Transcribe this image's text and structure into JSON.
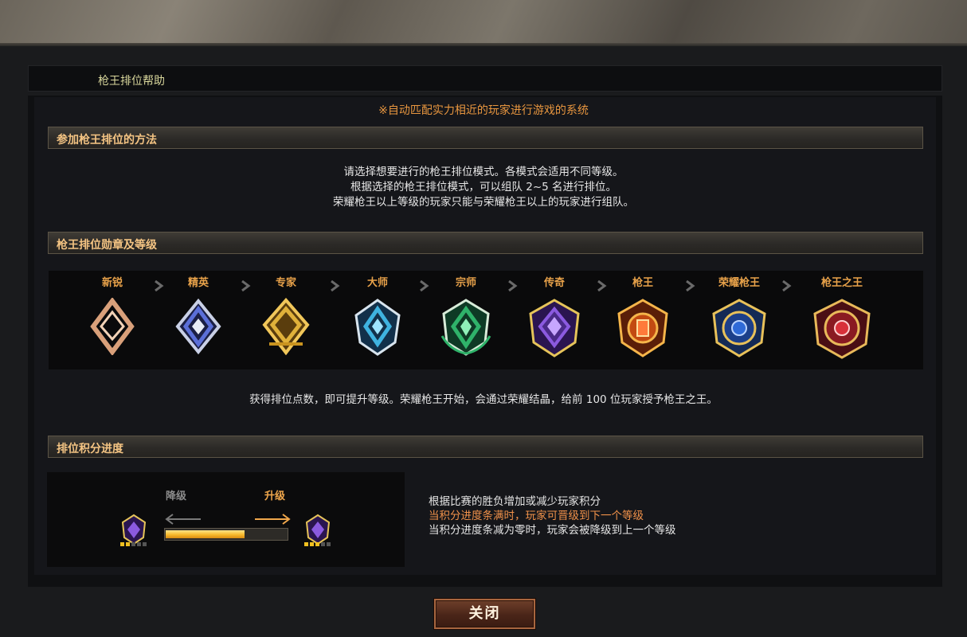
{
  "window": {
    "title": "枪王排位帮助"
  },
  "notice": "※自动匹配实力相近的玩家进行游戏的系统",
  "sections": [
    {
      "header": "参加枪王排位的方法",
      "lines": [
        "请选择想要进行的枪王排位模式。各模式会适用不同等级。",
        "根据选择的枪王排位模式，可以组队 2~5 名进行排位。",
        "荣耀枪王以上等级的玩家只能与荣耀枪王以上的玩家进行组队。"
      ]
    },
    {
      "header": "枪王排位勋章及等级",
      "ranks": [
        {
          "label": "新锐",
          "icon": "rank-newcomer-icon",
          "color": "#d9a07a"
        },
        {
          "label": "精英",
          "icon": "rank-elite-icon",
          "color": "#5b6fd8"
        },
        {
          "label": "专家",
          "icon": "rank-expert-icon",
          "color": "#e0b13a"
        },
        {
          "label": "大师",
          "icon": "rank-master-icon",
          "color": "#3fb3e0"
        },
        {
          "label": "宗师",
          "icon": "rank-grandmaster-icon",
          "color": "#2fb36a"
        },
        {
          "label": "传奇",
          "icon": "rank-legend-icon",
          "color": "#8b5ae0"
        },
        {
          "label": "枪王",
          "icon": "rank-gunking-icon",
          "color": "#e8682a"
        },
        {
          "label": "荣耀枪王",
          "icon": "rank-glory-gunking-icon",
          "color": "#2f6ad8"
        },
        {
          "label": "枪王之王",
          "icon": "rank-king-of-gunkings-icon",
          "color": "#d8303a"
        }
      ],
      "footer": "获得排位点数，即可提升等级。荣耀枪王开始，会通过荣耀结晶，给前 100 位玩家授予枪王之王。"
    },
    {
      "header": "排位积分进度",
      "demote_label": "降级",
      "promote_label": "升级",
      "progress": 0.65,
      "lines": [
        "根据比赛的胜负增加或减少玩家积分",
        "当积分进度条满时，玩家可晋级到下一个等级",
        "当积分进度条减为零时，玩家会被降级到上一个等级"
      ]
    }
  ],
  "close_button": "关闭",
  "colors": {
    "accent_orange": "#e8963f",
    "header_text": "#f4c483",
    "title_text": "#d9d79c",
    "highlight_line": "#f0914a"
  }
}
